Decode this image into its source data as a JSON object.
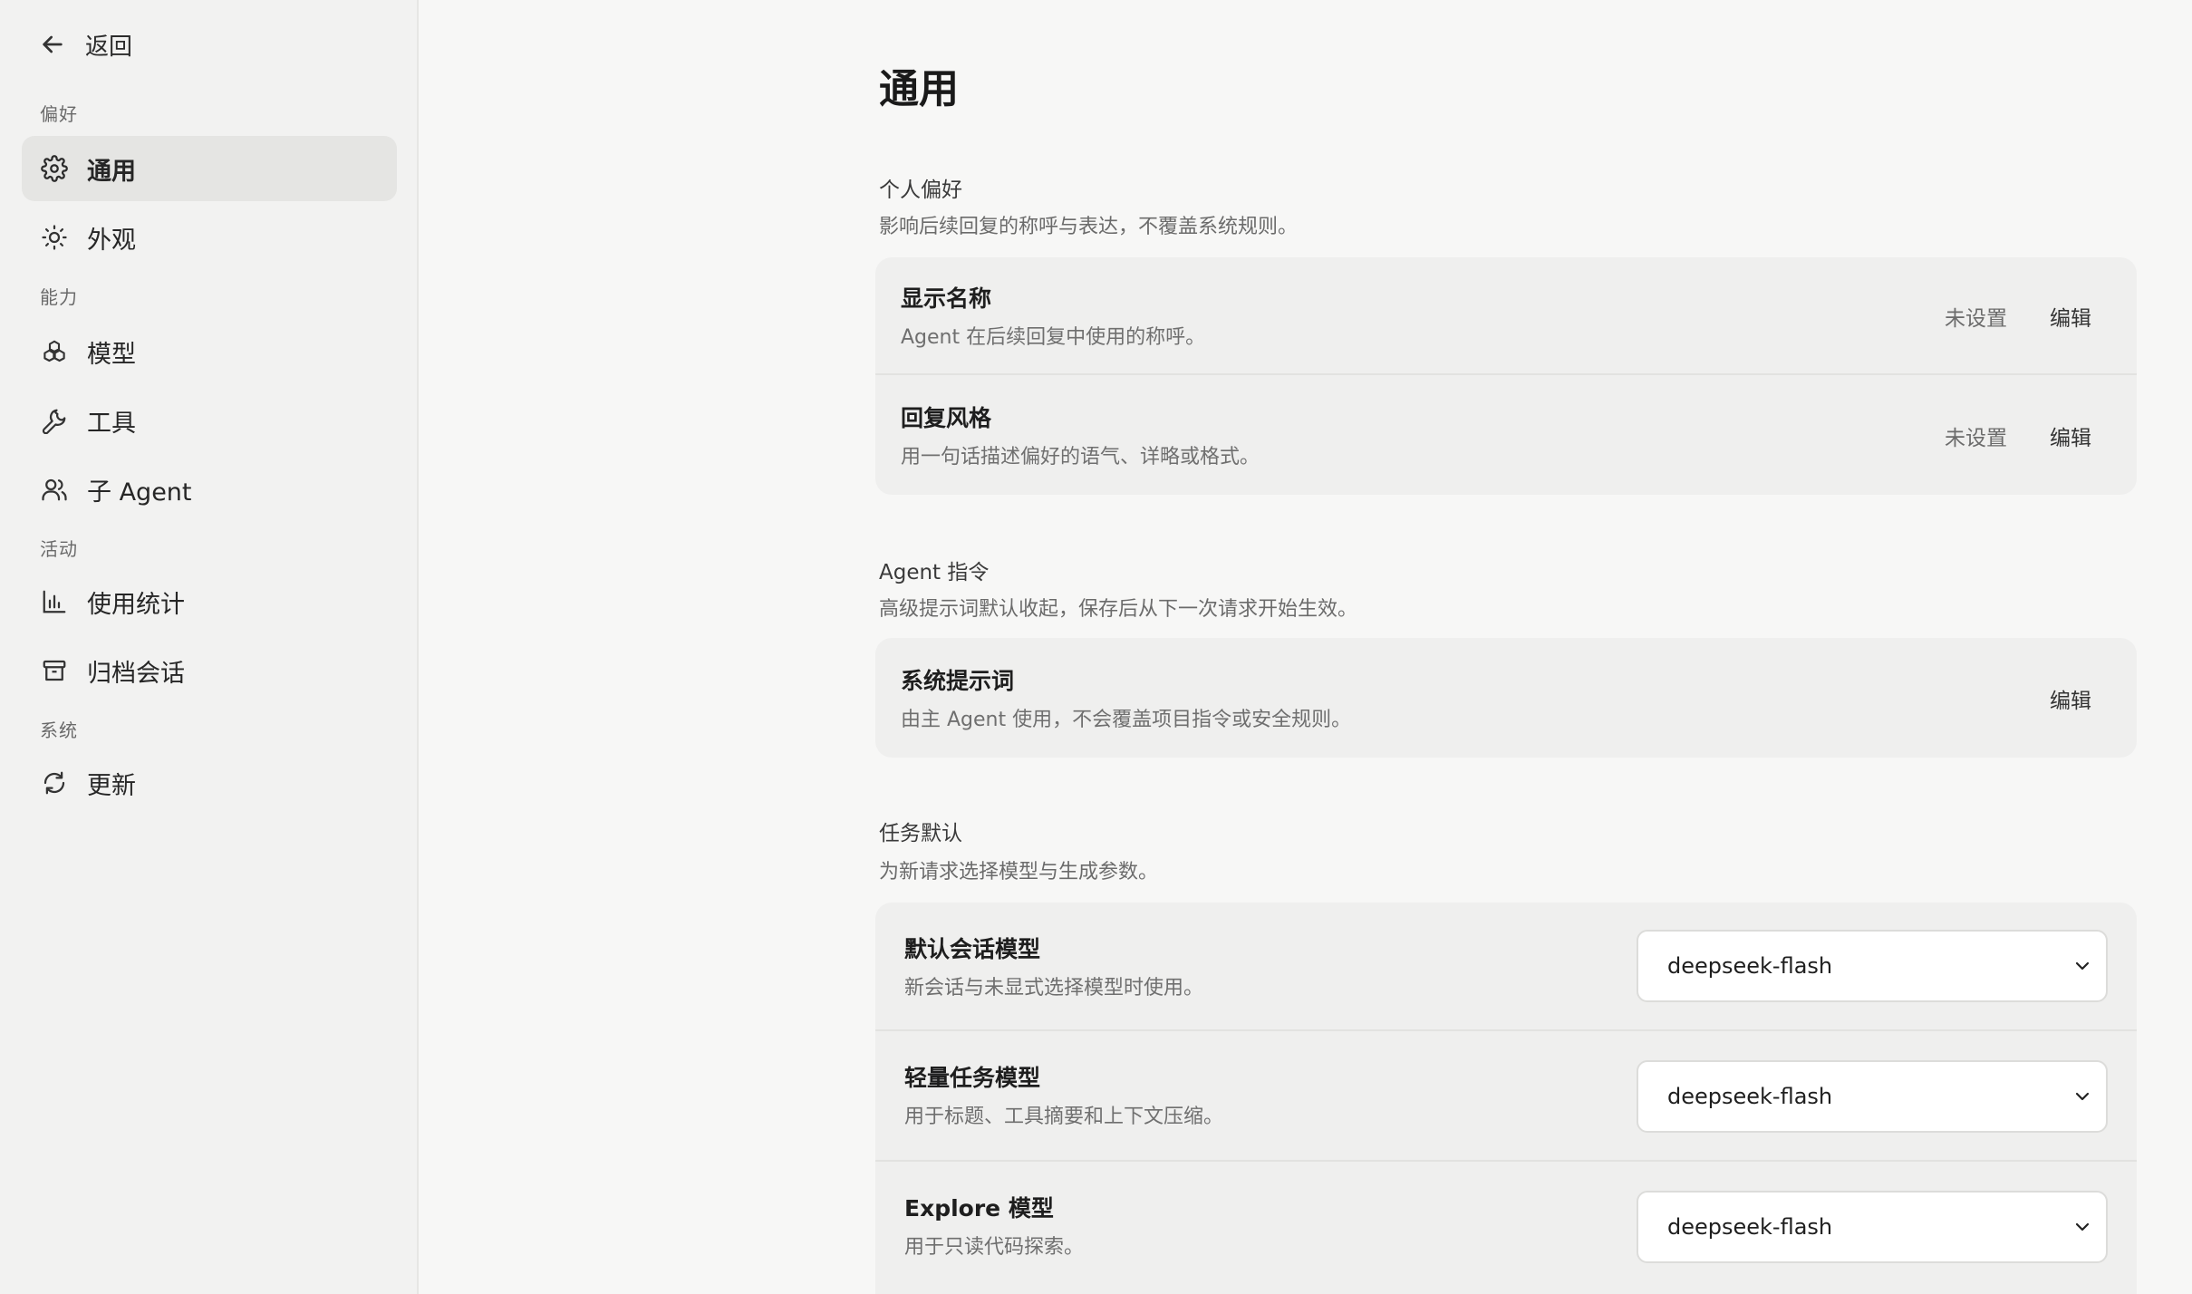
{
  "sidebar": {
    "back_label": "返回",
    "groups": [
      {
        "label": "偏好"
      },
      {
        "label": "能力"
      },
      {
        "label": "活动"
      },
      {
        "label": "系统"
      }
    ],
    "items": [
      {
        "label": "通用",
        "icon": "gear-icon",
        "active": true
      },
      {
        "label": "外观",
        "icon": "sun-icon"
      },
      {
        "label": "模型",
        "icon": "cubes-icon"
      },
      {
        "label": "工具",
        "icon": "wrench-icon"
      },
      {
        "label": "子 Agent",
        "icon": "users-icon"
      },
      {
        "label": "使用统计",
        "icon": "bar-chart-icon"
      },
      {
        "label": "归档会话",
        "icon": "archive-icon"
      },
      {
        "label": "更新",
        "icon": "refresh-icon"
      }
    ]
  },
  "main": {
    "title": "通用",
    "sections": [
      {
        "title": "个人偏好",
        "desc": "影响后续回复的称呼与表达，不覆盖系统规则。",
        "rows": [
          {
            "title": "显示名称",
            "desc": "Agent 在后续回复中使用的称呼。",
            "status": "未设置",
            "edit": "编辑"
          },
          {
            "title": "回复风格",
            "desc": "用一句话描述偏好的语气、详略或格式。",
            "status": "未设置",
            "edit": "编辑"
          }
        ]
      },
      {
        "title": "Agent 指令",
        "desc": "高级提示词默认收起，保存后从下一次请求开始生效。",
        "rows": [
          {
            "title": "系统提示词",
            "desc": "由主 Agent 使用，不会覆盖项目指令或安全规则。",
            "edit": "编辑"
          }
        ]
      },
      {
        "title": "任务默认",
        "desc": "为新请求选择模型与生成参数。",
        "rows": [
          {
            "title": "默认会话模型",
            "desc": "新会话与未显式选择模型时使用。",
            "value": "deepseek-flash"
          },
          {
            "title": "轻量任务模型",
            "desc": "用于标题、工具摘要和上下文压缩。",
            "value": "deepseek-flash"
          },
          {
            "title": "Explore 模型",
            "desc": "用于只读代码探索。",
            "value": "deepseek-flash"
          }
        ]
      }
    ]
  }
}
